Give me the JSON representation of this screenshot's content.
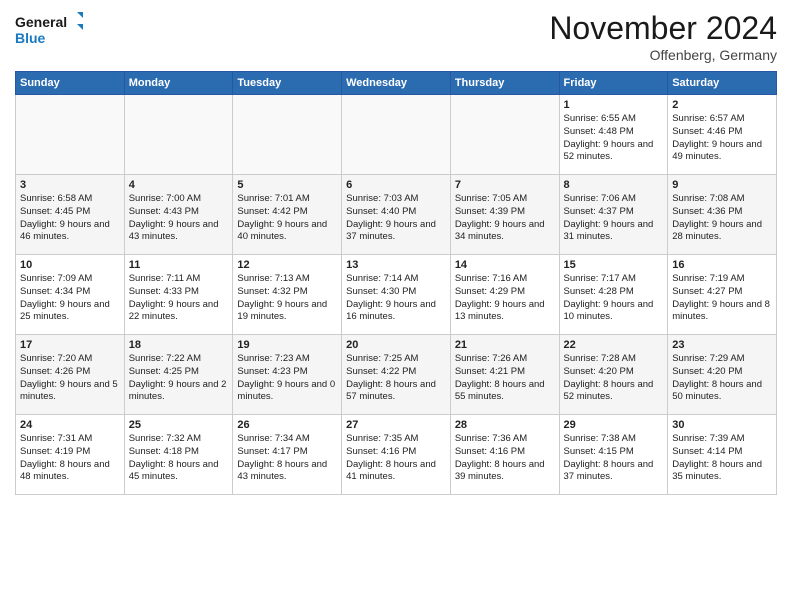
{
  "logo": {
    "line1": "General",
    "line2": "Blue"
  },
  "title": "November 2024",
  "location": "Offenberg, Germany",
  "header": {
    "days": [
      "Sunday",
      "Monday",
      "Tuesday",
      "Wednesday",
      "Thursday",
      "Friday",
      "Saturday"
    ]
  },
  "weeks": [
    [
      {
        "day": "",
        "sunrise": "",
        "sunset": "",
        "daylight": ""
      },
      {
        "day": "",
        "sunrise": "",
        "sunset": "",
        "daylight": ""
      },
      {
        "day": "",
        "sunrise": "",
        "sunset": "",
        "daylight": ""
      },
      {
        "day": "",
        "sunrise": "",
        "sunset": "",
        "daylight": ""
      },
      {
        "day": "",
        "sunrise": "",
        "sunset": "",
        "daylight": ""
      },
      {
        "day": "1",
        "sunrise": "Sunrise: 6:55 AM",
        "sunset": "Sunset: 4:48 PM",
        "daylight": "Daylight: 9 hours and 52 minutes."
      },
      {
        "day": "2",
        "sunrise": "Sunrise: 6:57 AM",
        "sunset": "Sunset: 4:46 PM",
        "daylight": "Daylight: 9 hours and 49 minutes."
      }
    ],
    [
      {
        "day": "3",
        "sunrise": "Sunrise: 6:58 AM",
        "sunset": "Sunset: 4:45 PM",
        "daylight": "Daylight: 9 hours and 46 minutes."
      },
      {
        "day": "4",
        "sunrise": "Sunrise: 7:00 AM",
        "sunset": "Sunset: 4:43 PM",
        "daylight": "Daylight: 9 hours and 43 minutes."
      },
      {
        "day": "5",
        "sunrise": "Sunrise: 7:01 AM",
        "sunset": "Sunset: 4:42 PM",
        "daylight": "Daylight: 9 hours and 40 minutes."
      },
      {
        "day": "6",
        "sunrise": "Sunrise: 7:03 AM",
        "sunset": "Sunset: 4:40 PM",
        "daylight": "Daylight: 9 hours and 37 minutes."
      },
      {
        "day": "7",
        "sunrise": "Sunrise: 7:05 AM",
        "sunset": "Sunset: 4:39 PM",
        "daylight": "Daylight: 9 hours and 34 minutes."
      },
      {
        "day": "8",
        "sunrise": "Sunrise: 7:06 AM",
        "sunset": "Sunset: 4:37 PM",
        "daylight": "Daylight: 9 hours and 31 minutes."
      },
      {
        "day": "9",
        "sunrise": "Sunrise: 7:08 AM",
        "sunset": "Sunset: 4:36 PM",
        "daylight": "Daylight: 9 hours and 28 minutes."
      }
    ],
    [
      {
        "day": "10",
        "sunrise": "Sunrise: 7:09 AM",
        "sunset": "Sunset: 4:34 PM",
        "daylight": "Daylight: 9 hours and 25 minutes."
      },
      {
        "day": "11",
        "sunrise": "Sunrise: 7:11 AM",
        "sunset": "Sunset: 4:33 PM",
        "daylight": "Daylight: 9 hours and 22 minutes."
      },
      {
        "day": "12",
        "sunrise": "Sunrise: 7:13 AM",
        "sunset": "Sunset: 4:32 PM",
        "daylight": "Daylight: 9 hours and 19 minutes."
      },
      {
        "day": "13",
        "sunrise": "Sunrise: 7:14 AM",
        "sunset": "Sunset: 4:30 PM",
        "daylight": "Daylight: 9 hours and 16 minutes."
      },
      {
        "day": "14",
        "sunrise": "Sunrise: 7:16 AM",
        "sunset": "Sunset: 4:29 PM",
        "daylight": "Daylight: 9 hours and 13 minutes."
      },
      {
        "day": "15",
        "sunrise": "Sunrise: 7:17 AM",
        "sunset": "Sunset: 4:28 PM",
        "daylight": "Daylight: 9 hours and 10 minutes."
      },
      {
        "day": "16",
        "sunrise": "Sunrise: 7:19 AM",
        "sunset": "Sunset: 4:27 PM",
        "daylight": "Daylight: 9 hours and 8 minutes."
      }
    ],
    [
      {
        "day": "17",
        "sunrise": "Sunrise: 7:20 AM",
        "sunset": "Sunset: 4:26 PM",
        "daylight": "Daylight: 9 hours and 5 minutes."
      },
      {
        "day": "18",
        "sunrise": "Sunrise: 7:22 AM",
        "sunset": "Sunset: 4:25 PM",
        "daylight": "Daylight: 9 hours and 2 minutes."
      },
      {
        "day": "19",
        "sunrise": "Sunrise: 7:23 AM",
        "sunset": "Sunset: 4:23 PM",
        "daylight": "Daylight: 9 hours and 0 minutes."
      },
      {
        "day": "20",
        "sunrise": "Sunrise: 7:25 AM",
        "sunset": "Sunset: 4:22 PM",
        "daylight": "Daylight: 8 hours and 57 minutes."
      },
      {
        "day": "21",
        "sunrise": "Sunrise: 7:26 AM",
        "sunset": "Sunset: 4:21 PM",
        "daylight": "Daylight: 8 hours and 55 minutes."
      },
      {
        "day": "22",
        "sunrise": "Sunrise: 7:28 AM",
        "sunset": "Sunset: 4:20 PM",
        "daylight": "Daylight: 8 hours and 52 minutes."
      },
      {
        "day": "23",
        "sunrise": "Sunrise: 7:29 AM",
        "sunset": "Sunset: 4:20 PM",
        "daylight": "Daylight: 8 hours and 50 minutes."
      }
    ],
    [
      {
        "day": "24",
        "sunrise": "Sunrise: 7:31 AM",
        "sunset": "Sunset: 4:19 PM",
        "daylight": "Daylight: 8 hours and 48 minutes."
      },
      {
        "day": "25",
        "sunrise": "Sunrise: 7:32 AM",
        "sunset": "Sunset: 4:18 PM",
        "daylight": "Daylight: 8 hours and 45 minutes."
      },
      {
        "day": "26",
        "sunrise": "Sunrise: 7:34 AM",
        "sunset": "Sunset: 4:17 PM",
        "daylight": "Daylight: 8 hours and 43 minutes."
      },
      {
        "day": "27",
        "sunrise": "Sunrise: 7:35 AM",
        "sunset": "Sunset: 4:16 PM",
        "daylight": "Daylight: 8 hours and 41 minutes."
      },
      {
        "day": "28",
        "sunrise": "Sunrise: 7:36 AM",
        "sunset": "Sunset: 4:16 PM",
        "daylight": "Daylight: 8 hours and 39 minutes."
      },
      {
        "day": "29",
        "sunrise": "Sunrise: 7:38 AM",
        "sunset": "Sunset: 4:15 PM",
        "daylight": "Daylight: 8 hours and 37 minutes."
      },
      {
        "day": "30",
        "sunrise": "Sunrise: 7:39 AM",
        "sunset": "Sunset: 4:14 PM",
        "daylight": "Daylight: 8 hours and 35 minutes."
      }
    ]
  ]
}
